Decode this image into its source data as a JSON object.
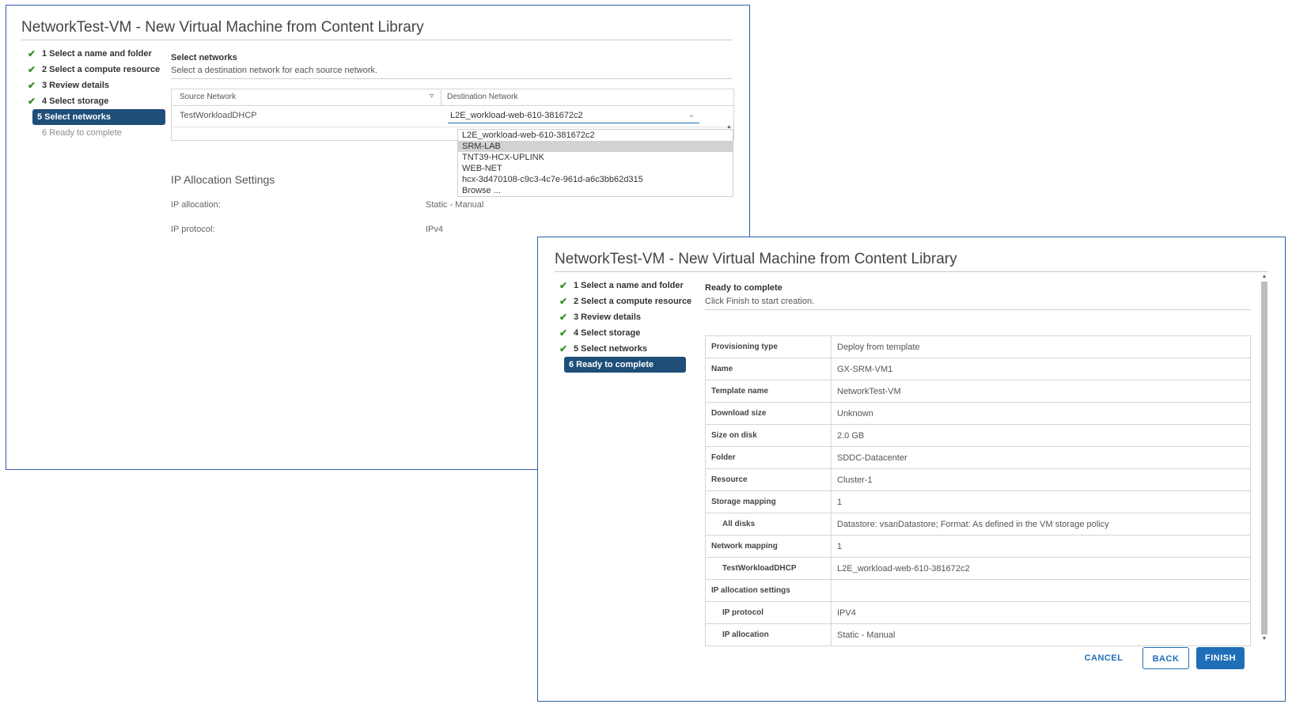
{
  "dialog1": {
    "title": "NetworkTest-VM - New Virtual Machine from Content Library",
    "steps": [
      {
        "label": "1 Select a name and folder",
        "state": "done"
      },
      {
        "label": "2 Select a compute resource",
        "state": "done"
      },
      {
        "label": "3 Review details",
        "state": "done"
      },
      {
        "label": "4 Select storage",
        "state": "done"
      },
      {
        "label": "5 Select networks",
        "state": "active"
      },
      {
        "label": "6 Ready to complete",
        "state": "disabled"
      }
    ],
    "section_title": "Select networks",
    "section_subtitle": "Select a destination network for each source network.",
    "grid": {
      "col_source": "Source Network",
      "col_destination": "Destination Network",
      "row_source": "TestWorkloadDHCP",
      "row_destination": "L2E_workload-web-610-381672c2"
    },
    "dropdown_options": [
      "L2E_workload-web-610-381672c2",
      "SRM-LAB",
      "TNT39-HCX-UPLINK",
      "WEB-NET",
      "hcx-3d470108-c9c3-4c7e-961d-a6c3bb62d315",
      "Browse ..."
    ],
    "dropdown_highlighted": "SRM-LAB",
    "ip_title": "IP Allocation Settings",
    "ip_allocation_label": "IP allocation:",
    "ip_allocation_value": "Static - Manual",
    "ip_protocol_label": "IP protocol:",
    "ip_protocol_value": "IPv4"
  },
  "dialog2": {
    "title": "NetworkTest-VM - New Virtual Machine from Content Library",
    "steps": [
      {
        "label": "1 Select a name and folder",
        "state": "done"
      },
      {
        "label": "2 Select a compute resource",
        "state": "done"
      },
      {
        "label": "3 Review details",
        "state": "done"
      },
      {
        "label": "4 Select storage",
        "state": "done"
      },
      {
        "label": "5 Select networks",
        "state": "done"
      },
      {
        "label": "6 Ready to complete",
        "state": "active"
      }
    ],
    "section_title": "Ready to complete",
    "section_subtitle": "Click Finish to start creation.",
    "summary": [
      {
        "key": "Provisioning type",
        "value": "Deploy from template",
        "sub": false
      },
      {
        "key": "Name",
        "value": "GX-SRM-VM1",
        "sub": false
      },
      {
        "key": "Template name",
        "value": "NetworkTest-VM",
        "sub": false
      },
      {
        "key": "Download size",
        "value": "Unknown",
        "sub": false
      },
      {
        "key": "Size on disk",
        "value": "2.0 GB",
        "sub": false
      },
      {
        "key": "Folder",
        "value": "SDDC-Datacenter",
        "sub": false
      },
      {
        "key": "Resource",
        "value": "Cluster-1",
        "sub": false
      },
      {
        "key": "Storage mapping",
        "value": "1",
        "sub": false
      },
      {
        "key": "All disks",
        "value": "Datastore: vsanDatastore; Format: As defined in the VM storage policy",
        "sub": true
      },
      {
        "key": "Network mapping",
        "value": "1",
        "sub": false
      },
      {
        "key": "TestWorkloadDHCP",
        "value": "L2E_workload-web-610-381672c2",
        "sub": true
      },
      {
        "key": "IP allocation settings",
        "value": "",
        "sub": false
      },
      {
        "key": "IP protocol",
        "value": "IPV4",
        "sub": true
      },
      {
        "key": "IP allocation",
        "value": "Static - Manual",
        "sub": true
      }
    ],
    "buttons": {
      "cancel": "CANCEL",
      "back": "BACK",
      "finish": "FINISH"
    }
  },
  "icons": {
    "check": "checkmark-icon",
    "filter": "filter-icon",
    "chevron": "chevron-down-icon"
  },
  "colors": {
    "active_step": "#1f4e79",
    "primary": "#1f6fb8",
    "check": "#3c8a2e",
    "border": "#2f5fa8"
  }
}
